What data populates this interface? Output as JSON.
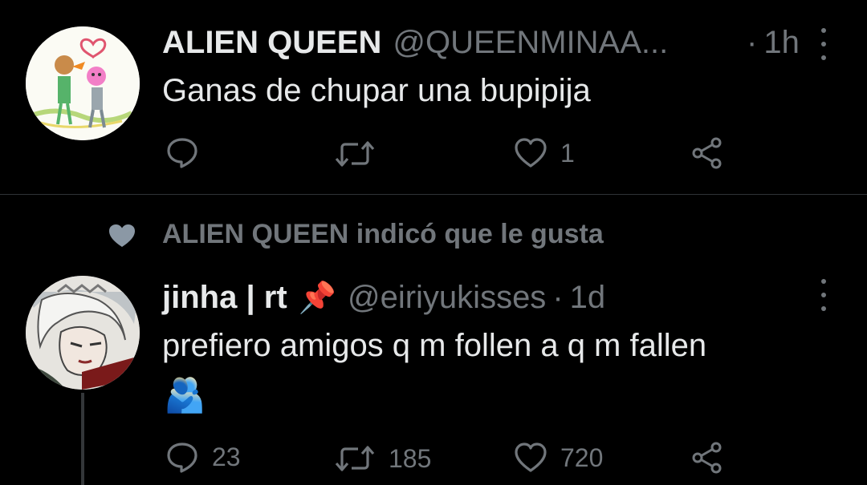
{
  "tweet1": {
    "display_name": "ALIEN QUEEN",
    "handle": "@QUEENMINAA...",
    "separator": "·",
    "time": "1h",
    "text": "Ganas de chupar una bupipija",
    "actions": {
      "reply": "",
      "retweet": "",
      "like": "1",
      "share": ""
    }
  },
  "social_context": {
    "text": "ALIEN QUEEN indicó que le gusta",
    "icon": "heart-icon"
  },
  "tweet2": {
    "display_name": "jinha | rt",
    "pin_emoji": "📌",
    "handle": "@eiriyukisses",
    "separator": "·",
    "time": "1d",
    "text": "prefiero amigos q m follen a q m fallen",
    "emoji": "🫂",
    "actions": {
      "reply": "23",
      "retweet": "185",
      "like": "720",
      "share": ""
    }
  },
  "colors": {
    "background": "#000000",
    "text": "#e7e9ea",
    "muted": "#71767b",
    "divider": "#2f3336"
  }
}
